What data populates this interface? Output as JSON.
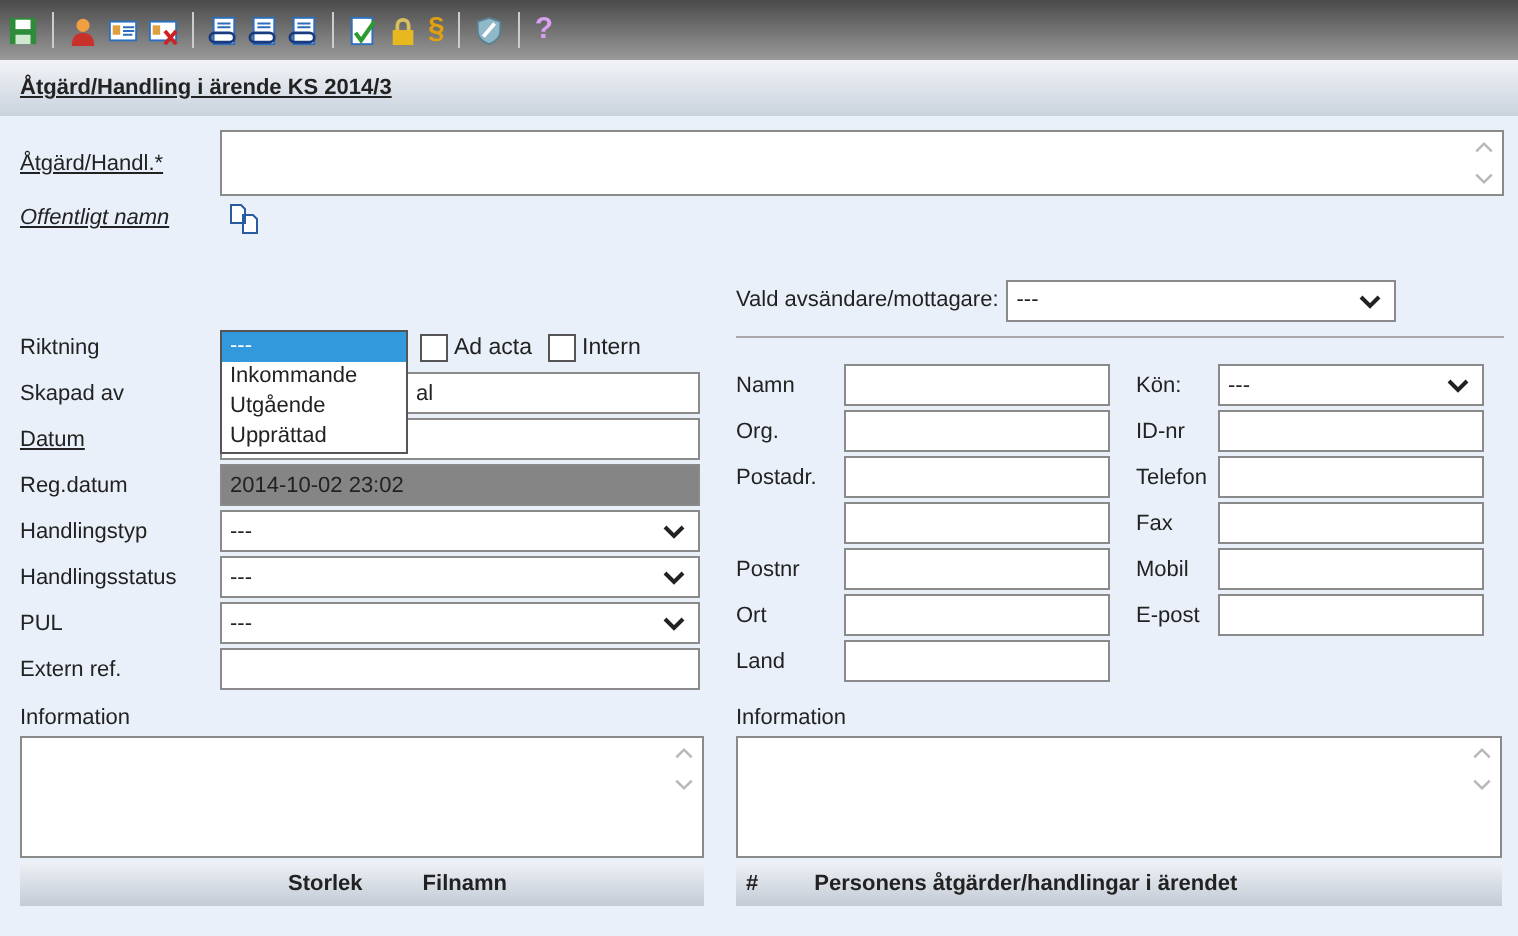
{
  "toolbar": [
    {
      "kind": "save"
    },
    {
      "kind": "sep"
    },
    {
      "kind": "person"
    },
    {
      "kind": "card"
    },
    {
      "kind": "card-delete"
    },
    {
      "kind": "sep"
    },
    {
      "kind": "clip-doc"
    },
    {
      "kind": "clip-doc"
    },
    {
      "kind": "clip-doc"
    },
    {
      "kind": "sep"
    },
    {
      "kind": "check-doc"
    },
    {
      "kind": "lock"
    },
    {
      "kind": "glyph",
      "text": "§"
    },
    {
      "kind": "sep"
    },
    {
      "kind": "shield"
    },
    {
      "kind": "sep"
    },
    {
      "kind": "glyph",
      "text": "?"
    }
  ],
  "title": "Åtgärd/Handling i ärende KS 2014/3",
  "action_field": {
    "label": "Åtgärd/Handl.*"
  },
  "public_name": {
    "label": "Offentligt namn"
  },
  "direction": {
    "label": "Riktning",
    "expanded": true,
    "options": [
      {
        "label": "---",
        "selected": true
      },
      {
        "label": "Inkommande",
        "selected": false
      },
      {
        "label": "Utgående",
        "selected": false
      },
      {
        "label": "Upprättad",
        "selected": false
      }
    ]
  },
  "flags": [
    {
      "label": "Ad acta",
      "checked": false
    },
    {
      "label": "Intern",
      "checked": false
    }
  ],
  "left_fields": [
    {
      "label": "Skapad av",
      "underlined": false,
      "kind": "text",
      "value": "al"
    },
    {
      "label": "Datum",
      "underlined": true,
      "kind": "text"
    },
    {
      "label": "Reg.datum",
      "underlined": false,
      "kind": "readonly",
      "value": "2014-10-02 23:02"
    },
    {
      "label": "Handlingstyp",
      "underlined": false,
      "kind": "select",
      "value": "---"
    },
    {
      "label": "Handlingsstatus",
      "underlined": false,
      "kind": "select",
      "value": "---"
    },
    {
      "label": "PUL",
      "underlined": false,
      "kind": "select",
      "value": "---"
    },
    {
      "label": "Extern ref.",
      "underlined": false,
      "kind": "text"
    }
  ],
  "sender": {
    "label": "Vald avsändare/mottagare:",
    "value": "---"
  },
  "contact_left": [
    {
      "label": "Namn"
    },
    {
      "label": "Org."
    },
    {
      "label": "Postadr.",
      "extra_line": true
    },
    {
      "label": "Postnr"
    },
    {
      "label": "Ort"
    },
    {
      "label": "Land"
    }
  ],
  "contact_right": [
    {
      "label": "Kön:",
      "kind": "select",
      "value": "---"
    },
    {
      "label": "ID-nr",
      "kind": "text"
    },
    {
      "label": "Telefon",
      "kind": "text"
    },
    {
      "label": "Fax",
      "kind": "text"
    },
    {
      "label": "Mobil",
      "kind": "text"
    },
    {
      "label": "E-post",
      "kind": "text"
    }
  ],
  "info_left": {
    "label": "Information",
    "columns": [
      "Storlek",
      "Filnamn"
    ]
  },
  "info_right": {
    "label": "Information",
    "columns": [
      "#",
      "Personens åtgärder/handlingar i ärendet"
    ]
  }
}
